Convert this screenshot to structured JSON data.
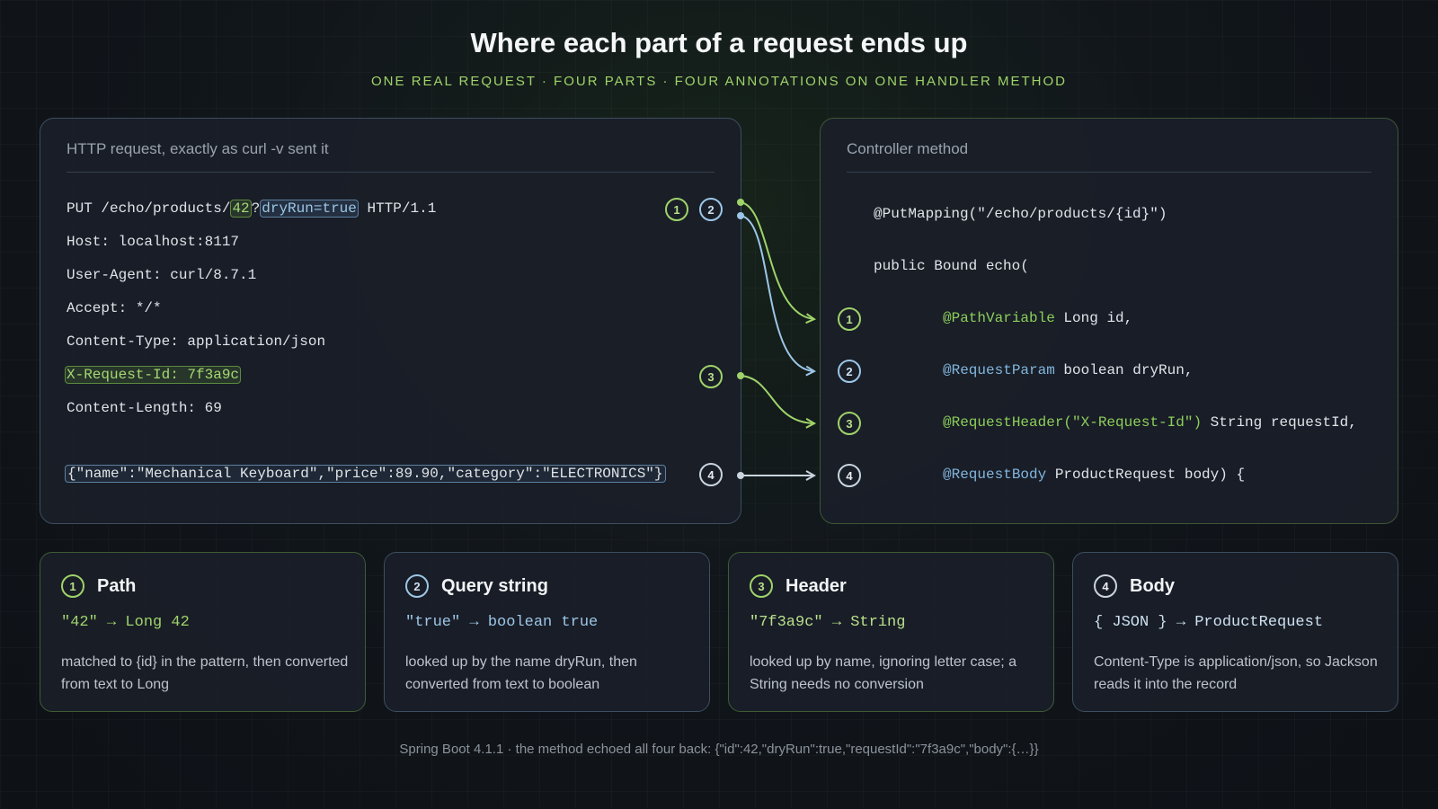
{
  "title": "Where each part of a request ends up",
  "subtitle": "ONE REAL REQUEST · FOUR PARTS · FOUR ANNOTATIONS ON ONE HANDLER METHOD",
  "request": {
    "title": "HTTP request, exactly as curl -v sent it",
    "line1": {
      "prefix": "PUT /echo/products/",
      "path_value": "42",
      "sep": "?",
      "query_value": "dryRun=true",
      "suffix": " HTTP/1.1"
    },
    "headers": [
      "Host: localhost:8117",
      "User-Agent: curl/8.7.1",
      "Accept: */*",
      "Content-Type: application/json"
    ],
    "request_id_header": "X-Request-Id: 7f3a9c",
    "content_length": "Content-Length: 69",
    "body": "{\"name\":\"Mechanical Keyboard\",\"price\":89.90,\"category\":\"ELECTRONICS\"}"
  },
  "controller": {
    "title": "Controller method",
    "mapping": "@PutMapping(\"/echo/products/{id}\")",
    "signature": "public Bound echo(",
    "params": [
      {
        "annotation": "@PathVariable",
        "rest": " Long id,"
      },
      {
        "annotation": "@RequestParam",
        "rest": " boolean dryRun,"
      },
      {
        "annotation": "@RequestHeader(\"X-Request-Id\")",
        "rest": " String requestId,"
      },
      {
        "annotation": "@RequestBody",
        "rest": " ProductRequest body) {"
      }
    ]
  },
  "badges": [
    "1",
    "2",
    "3",
    "4"
  ],
  "cards": [
    {
      "title": "Path",
      "mapping": "\"42\" → Long 42",
      "desc": "matched to {id} in the pattern, then converted from text to Long"
    },
    {
      "title": "Query string",
      "mapping": "\"true\" → boolean true",
      "desc": "looked up by the name dryRun, then converted from text to boolean"
    },
    {
      "title": "Header",
      "mapping": "\"7f3a9c\" → String",
      "desc": "looked up by name, ignoring letter case; a String needs no conversion"
    },
    {
      "title": "Body",
      "mapping": "{ JSON } → ProductRequest",
      "desc": "Content-Type is application/json, so Jackson reads it into the record"
    }
  ],
  "footer": "Spring Boot 4.1.1 · the method echoed all four back: {\"id\":42,\"dryRun\":true,\"requestId\":\"7f3a9c\",\"body\":{…}}",
  "colors": {
    "green": "#9fd36a",
    "blue": "#9cc6e6",
    "white": "#c9d4de"
  }
}
